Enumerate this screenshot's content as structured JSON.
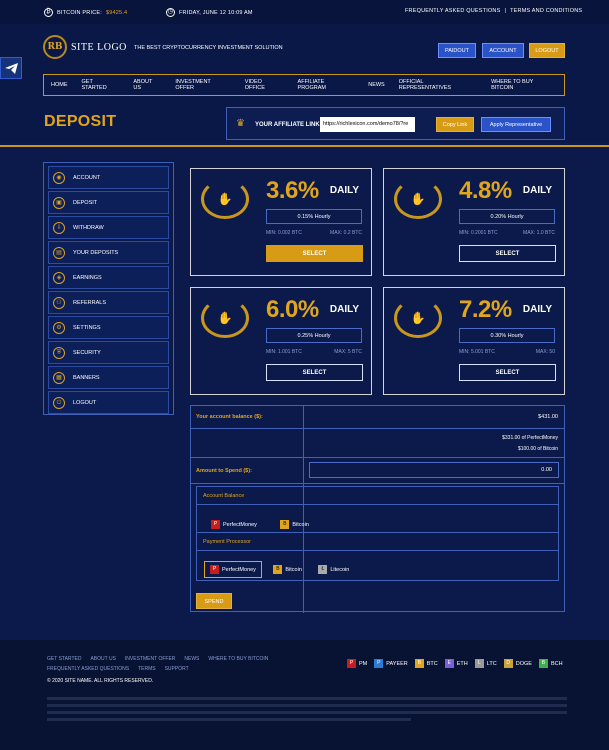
{
  "topbar": {
    "btc_label": "BITCOIN PRICE:",
    "btc_value": "$9425.4",
    "date": "FRIDAY, JUNE 12 10:09 AM",
    "faq": "FREQUENTLY ASKED QUESTIONS",
    "sep": "|",
    "terms": "TERMS AND CONDITIONS"
  },
  "logo": {
    "mark": "RB",
    "text": "SITE LOGO",
    "tagline": "THE BEST CRYPTOCURRENCY INVESTMENT SOLUTION"
  },
  "header_buttons": {
    "payout": "PAIDOUT",
    "account": "ACCOUNT",
    "logout": "LOGOUT"
  },
  "nav": [
    "HOME",
    "GET STARTED",
    "ABOUT US",
    "INVESTMENT OFFER",
    "VIDEO OFFICE",
    "AFFILIATE PROGRAM",
    "NEWS",
    "OFFICIAL REPRESENTATIVES",
    "WHERE TO BUY BITCOIN"
  ],
  "page_title": "DEPOSIT",
  "affiliate": {
    "label": "YOUR AFFILIATE LINK:",
    "value": "https://richlexicon.com/demo78/?re",
    "copy": "Copy Link",
    "apply": "Apply Representative"
  },
  "sidebar": [
    "ACCOUNT",
    "DEPOSIT",
    "WITHDRAW",
    "YOUR DEPOSITS",
    "EARNINGS",
    "REFERRALS",
    "SETTINGS",
    "SECURITY",
    "BANNERS",
    "LOGOUT"
  ],
  "plans": [
    {
      "pct": "3.6%",
      "period": "DAILY",
      "hourly": "0.15% Hourly",
      "min": "MIN: 0.002 BTC",
      "max": "MAX: 0.2 BTC",
      "select": "SELECT",
      "active": true
    },
    {
      "pct": "4.8%",
      "period": "DAILY",
      "hourly": "0.20% Hourly",
      "min": "MIN: 0.2001 BTC",
      "max": "MAX: 1.0 BTC",
      "select": "SELECT",
      "active": false
    },
    {
      "pct": "6.0%",
      "period": "DAILY",
      "hourly": "0.25% Hourly",
      "min": "MIN: 1.001 BTC",
      "max": "MAX: 5 BTC",
      "select": "SELECT",
      "active": false
    },
    {
      "pct": "7.2%",
      "period": "DAILY",
      "hourly": "0.30% Hourly",
      "min": "MIN: 5.001 BTC",
      "max": "MAX: 50",
      "select": "SELECT",
      "active": false
    }
  ],
  "form": {
    "balance_label": "Your account balance ($):",
    "balance": "$431.00",
    "pm_balance": "$331.00 of PerfectMoney",
    "btc_balance": "$100.00 of Bitcoin",
    "amount_label": "Amount to Spend ($):",
    "amount": "0.00",
    "account_balance": "Account Balance",
    "processor": "Payment Processor",
    "pm": "PerfectMoney",
    "btc": "Bitcoin",
    "ltc": "Litecoin",
    "spend": "SPEND"
  },
  "footer": {
    "links1": [
      "GET STARTED",
      "ABOUT US",
      "INVESTMENT OFFER",
      "NEWS",
      "WHERE TO BUY BITCOIN"
    ],
    "links2": [
      "FREQUENTLY ASKED QUESTIONS",
      "TERMS",
      "SUPPORT"
    ],
    "copyright": "© 2020 SITE NAME. ALL RIGHTS RESERVED.",
    "currencies": [
      "PM",
      "PAYEER",
      "BTC",
      "ETH",
      "LTC",
      "DOGE",
      "BCH"
    ]
  },
  "colors": {
    "bg": "#0b1a4a",
    "gold": "#e0a51c",
    "blue": "#2a53c8"
  }
}
